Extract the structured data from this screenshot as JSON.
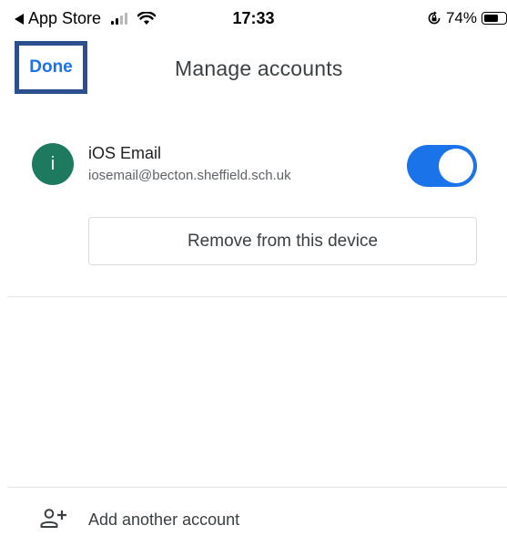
{
  "status_bar": {
    "back_app": "App Store",
    "time": "17:33",
    "battery_percent": "74%",
    "battery_level": 0.74,
    "icons": [
      "back-arrow-icon",
      "signal-icon",
      "wifi-icon",
      "orientation-lock-icon",
      "battery-icon"
    ]
  },
  "header": {
    "done_label": "Done",
    "title": "Manage accounts"
  },
  "account": {
    "avatar_letter": "i",
    "avatar_color": "#1e7a5f",
    "name": "iOS Email",
    "email": "iosemail@becton.sheffield.sch.uk",
    "enabled": true,
    "toggle_color": "#1a73e8",
    "remove_label": "Remove from this device"
  },
  "footer": {
    "add_account_label": "Add another account",
    "icon": "add-person-icon"
  },
  "colors": {
    "accent": "#1a73e8",
    "highlight_border": "#2b4f8f"
  }
}
